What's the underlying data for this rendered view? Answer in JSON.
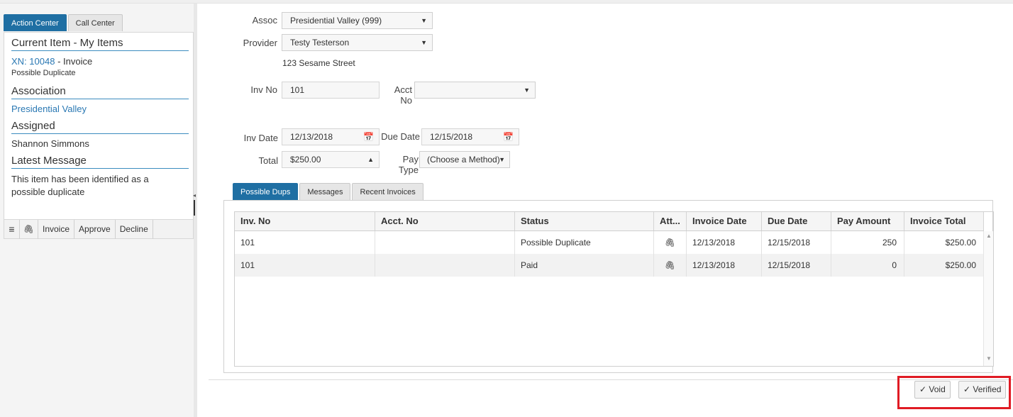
{
  "left_tabs": [
    "Action Center",
    "Call Center"
  ],
  "panel": {
    "current_item_title": "Current Item - My Items",
    "item_link": "XN: 10048",
    "item_type": "- Invoice",
    "item_status": "Possible Duplicate",
    "association_title": "Association",
    "association_value": "Presidential Valley",
    "assigned_title": "Assigned",
    "assigned_value": "Shannon Simmons",
    "latest_message_title": "Latest Message",
    "latest_message_value": "This item has been identified as a possible duplicate"
  },
  "left_toolbar": {
    "menu_icon": "≡",
    "attach_icon": "🖇",
    "invoice": "Invoice",
    "approve": "Approve",
    "decline": "Decline"
  },
  "form": {
    "assoc_label": "Assoc",
    "assoc_value": "Presidential Valley (999)",
    "provider_label": "Provider",
    "provider_value": "Testy Testerson",
    "address": "123 Sesame Street",
    "inv_no_label": "Inv No",
    "inv_no_value": "101",
    "acct_no_label": "Acct No",
    "acct_no_value": "",
    "inv_date_label": "Inv Date",
    "inv_date_value": "12/13/2018",
    "due_date_label": "Due Date",
    "due_date_value": "12/15/2018",
    "total_label": "Total",
    "total_value": "$250.00",
    "pay_type_label": "Pay Type",
    "pay_type_value": "(Choose a Method)"
  },
  "main_tabs": [
    "Possible Dups",
    "Messages",
    "Recent Invoices"
  ],
  "grid": {
    "columns": [
      "Inv. No",
      "Acct. No",
      "Status",
      "Att...",
      "Invoice Date",
      "Due Date",
      "Pay Amount",
      "Invoice Total"
    ],
    "rows": [
      [
        "101",
        "",
        "Possible Duplicate",
        "🖇",
        "12/13/2018",
        "12/15/2018",
        "250",
        "$250.00"
      ],
      [
        "101",
        "",
        "Paid",
        "🖇",
        "12/13/2018",
        "12/15/2018",
        "0",
        "$250.00"
      ]
    ]
  },
  "buttons": {
    "void": "Void",
    "verified": "Verified",
    "check_icon": "✓"
  },
  "colors": {
    "accent": "#1f6fa3",
    "link": "#2a78b3",
    "highlight": "#e01b24"
  }
}
